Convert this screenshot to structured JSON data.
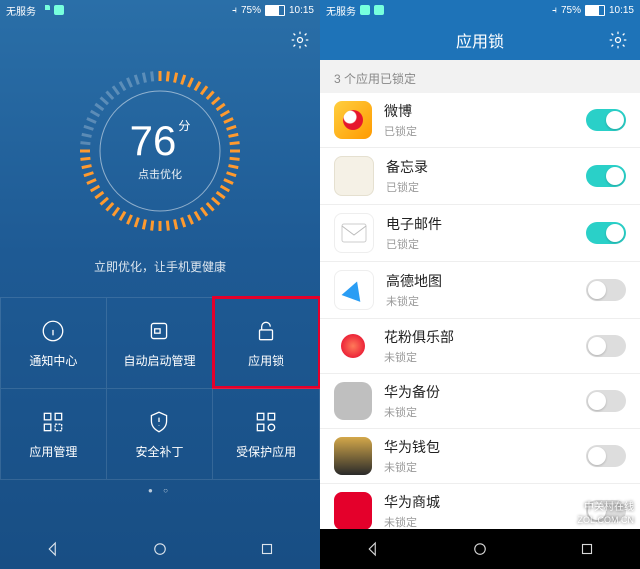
{
  "statusbar": {
    "carrier": "无服务",
    "battery_pct": "75%",
    "time": "10:15"
  },
  "left": {
    "score": "76",
    "score_unit": "分",
    "tap": "点击优化",
    "subtitle": "立即优化，让手机更健康",
    "cells": [
      {
        "label": "通知中心"
      },
      {
        "label": "自动启动管理"
      },
      {
        "label": "应用锁"
      },
      {
        "label": "应用管理"
      },
      {
        "label": "安全补丁"
      },
      {
        "label": "受保护应用"
      }
    ]
  },
  "right": {
    "title": "应用锁",
    "section": "3 个应用已锁定",
    "locked": "已锁定",
    "unlocked": "未锁定",
    "apps": [
      {
        "name": "微博",
        "locked": true,
        "ico": "weibo"
      },
      {
        "name": "备忘录",
        "locked": true,
        "ico": "memo"
      },
      {
        "name": "电子邮件",
        "locked": true,
        "ico": "mail"
      },
      {
        "name": "高德地图",
        "locked": false,
        "ico": "map"
      },
      {
        "name": "花粉俱乐部",
        "locked": false,
        "ico": "club"
      },
      {
        "name": "华为备份",
        "locked": false,
        "ico": "backup"
      },
      {
        "name": "华为钱包",
        "locked": false,
        "ico": "wallet"
      },
      {
        "name": "华为商城",
        "locked": false,
        "ico": "store"
      }
    ]
  },
  "watermark": {
    "cn": "中关村在线",
    "url": "ZOL.COM.CN"
  }
}
